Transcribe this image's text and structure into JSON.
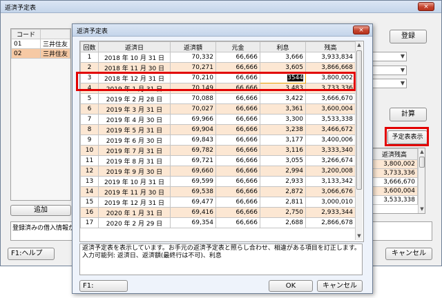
{
  "main_window": {
    "title": "返済予定表",
    "close_glyph": "×",
    "register_button": "登録",
    "calc_button": "計算",
    "show_schedule_button": "予定表表示",
    "add_button": "追加",
    "help_button": "F1:ヘルプ",
    "cancel_button": "キャンセル",
    "status_text": "登録済みの借入情報がス",
    "loan_table": {
      "header": "コード",
      "rows": [
        {
          "code": "01",
          "name": "三井住友"
        },
        {
          "code": "02",
          "name": "三井住友"
        }
      ]
    },
    "balance_table": {
      "header": "返済残高",
      "values": [
        "3,800,002",
        "3,733,336",
        "3,666,670",
        "3,600,004",
        "3,533,338"
      ]
    }
  },
  "dialog": {
    "title": "返済予定表",
    "close_glyph": "×",
    "columns": [
      "回数",
      "返済日",
      "返済額",
      "元金",
      "利息",
      "残高"
    ],
    "rows": [
      {
        "n": "1",
        "date": "2018 年 10 月 31 日",
        "payment": "70,332",
        "principal": "66,666",
        "interest": "3,666",
        "balance": "3,933,834"
      },
      {
        "n": "2",
        "date": "2018 年 11 月 30 日",
        "payment": "70,271",
        "principal": "66,666",
        "interest": "3,605",
        "balance": "3,866,668"
      },
      {
        "n": "3",
        "date": "2018 年 12 月 31 日",
        "payment": "70,210",
        "principal": "66,666",
        "interest": "3544",
        "balance": "3,800,002"
      },
      {
        "n": "4",
        "date": "2019 年 1 月 31 日",
        "payment": "70,149",
        "principal": "66,666",
        "interest": "3,483",
        "balance": "3,733,336"
      },
      {
        "n": "5",
        "date": "2019 年 2 月 28 日",
        "payment": "70,088",
        "principal": "66,666",
        "interest": "3,422",
        "balance": "3,666,670"
      },
      {
        "n": "6",
        "date": "2019 年 3 月 31 日",
        "payment": "70,027",
        "principal": "66,666",
        "interest": "3,361",
        "balance": "3,600,004"
      },
      {
        "n": "7",
        "date": "2019 年 4 月 30 日",
        "payment": "69,966",
        "principal": "66,666",
        "interest": "3,300",
        "balance": "3,533,338"
      },
      {
        "n": "8",
        "date": "2019 年 5 月 31 日",
        "payment": "69,904",
        "principal": "66,666",
        "interest": "3,238",
        "balance": "3,466,672"
      },
      {
        "n": "9",
        "date": "2019 年 6 月 30 日",
        "payment": "69,843",
        "principal": "66,666",
        "interest": "3,177",
        "balance": "3,400,006"
      },
      {
        "n": "10",
        "date": "2019 年 7 月 31 日",
        "payment": "69,782",
        "principal": "66,666",
        "interest": "3,116",
        "balance": "3,333,340"
      },
      {
        "n": "11",
        "date": "2019 年 8 月 31 日",
        "payment": "69,721",
        "principal": "66,666",
        "interest": "3,055",
        "balance": "3,266,674"
      },
      {
        "n": "12",
        "date": "2019 年 9 月 30 日",
        "payment": "69,660",
        "principal": "66,666",
        "interest": "2,994",
        "balance": "3,200,008"
      },
      {
        "n": "13",
        "date": "2019 年 10 月 31 日",
        "payment": "69,599",
        "principal": "66,666",
        "interest": "2,933",
        "balance": "3,133,342"
      },
      {
        "n": "14",
        "date": "2019 年 11 月 30 日",
        "payment": "69,538",
        "principal": "66,666",
        "interest": "2,872",
        "balance": "3,066,676"
      },
      {
        "n": "15",
        "date": "2019 年 12 月 31 日",
        "payment": "69,477",
        "principal": "66,666",
        "interest": "2,811",
        "balance": "3,000,010"
      },
      {
        "n": "16",
        "date": "2020 年 1 月 31 日",
        "payment": "69,416",
        "principal": "66,666",
        "interest": "2,750",
        "balance": "2,933,344"
      },
      {
        "n": "17",
        "date": "2020 年 2 月 29 日",
        "payment": "69,354",
        "principal": "66,666",
        "interest": "2,688",
        "balance": "2,866,678"
      }
    ],
    "message_line1": "返済予定表を表示しています。お手元の返済予定表と照らし合わせ、相違がある項目を訂正します。",
    "message_line2": "入力可能列: 返済日、返済額(最終行は不可)、利息",
    "f1_button": "F1:",
    "ok_button": "OK",
    "cancel_button": "キャンセル"
  },
  "colors": {
    "highlight_red": "#e20000",
    "row_alt": "#fce7d3",
    "selected_row": "#fbd9b8"
  }
}
